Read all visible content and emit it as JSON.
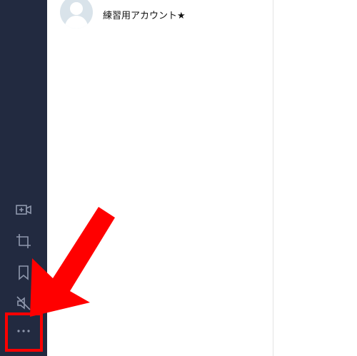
{
  "chat_list": {
    "items": [
      {
        "name": "練習用アカウント★",
        "avatar": "default-person-avatar"
      }
    ]
  },
  "sidebar": {
    "icons": [
      "video-plus-icon",
      "crop-icon",
      "bookmark-icon",
      "mute-icon",
      "more-icon"
    ],
    "color": "#222a40",
    "icon_color": "#8f98ad"
  },
  "annotation": {
    "color": "#ff0000",
    "target": "more-button"
  }
}
